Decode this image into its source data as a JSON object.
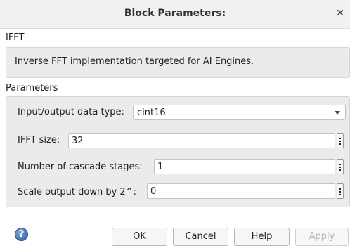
{
  "dialog": {
    "title": "Block Parameters:",
    "close_icon": "close-icon"
  },
  "block": {
    "name": "IFFT",
    "description": "Inverse FFT implementation targeted for AI Engines."
  },
  "parameters": {
    "section_title": "Parameters",
    "data_type": {
      "label": "Input/output data type:",
      "value": "cint16"
    },
    "ifft_size": {
      "label": "IFFT size:",
      "value": "32"
    },
    "cascade_stages": {
      "label": "Number of cascade stages:",
      "value": "1"
    },
    "scale_output": {
      "label": "Scale output down by 2^:",
      "value": "0"
    }
  },
  "buttons": {
    "ok": {
      "mnemonic": "O",
      "rest": "K"
    },
    "cancel": {
      "mnemonic": "C",
      "rest": "ancel"
    },
    "help": {
      "mnemonic": "H",
      "rest": "elp"
    },
    "apply": {
      "mnemonic": "A",
      "rest": "pply",
      "enabled": false
    }
  },
  "help_icon": "question-mark-icon"
}
